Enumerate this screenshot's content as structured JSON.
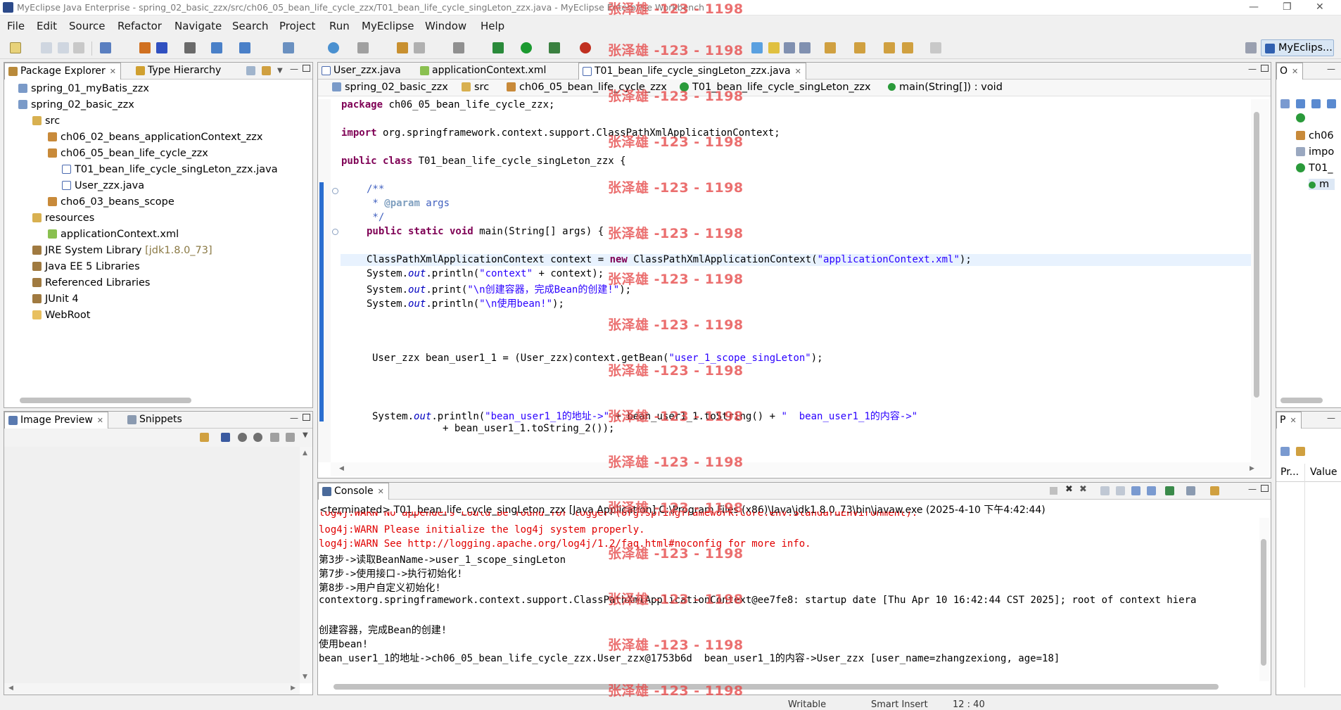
{
  "window": {
    "title": "MyEclipse Java Enterprise - spring_02_basic_zzx/src/ch06_05_bean_life_cycle_zzx/T01_bean_life_cycle_singLeton_zzx.java - MyEclipse Enterprise Workbench"
  },
  "menu": [
    "File",
    "Edit",
    "Source",
    "Refactor",
    "Navigate",
    "Search",
    "Project",
    "Run",
    "MyEclipse",
    "Window",
    "Help"
  ],
  "perspective": {
    "label": "MyEclips..."
  },
  "package_explorer": {
    "tabs": [
      {
        "label": "Package Explorer"
      },
      {
        "label": "Type Hierarchy"
      }
    ],
    "tree": [
      {
        "label": "spring_01_myBatis_zzx",
        "icon": "project-icon"
      },
      {
        "label": "spring_02_basic_zzx",
        "icon": "project-icon"
      },
      {
        "label": "src",
        "icon": "source-folder-icon"
      },
      {
        "label": "ch06_02_beans_applicationContext_zzx",
        "icon": "package-icon"
      },
      {
        "label": "ch06_05_bean_life_cycle_zzx",
        "icon": "package-icon"
      },
      {
        "label": "T01_bean_life_cycle_singLeton_zzx.java",
        "icon": "java-file-icon"
      },
      {
        "label": "User_zzx.java",
        "icon": "java-file-icon"
      },
      {
        "label": "cho6_03_beans_scope",
        "icon": "package-icon"
      },
      {
        "label": "resources",
        "icon": "source-folder-icon"
      },
      {
        "label": "applicationContext.xml",
        "icon": "xml-file-icon"
      },
      {
        "label": "JRE System Library",
        "suffix": "[jdk1.8.0_73]",
        "icon": "library-icon"
      },
      {
        "label": "Java EE 5 Libraries",
        "icon": "library-icon"
      },
      {
        "label": "Referenced Libraries",
        "icon": "library-icon"
      },
      {
        "label": "JUnit 4",
        "icon": "library-icon"
      },
      {
        "label": "WebRoot",
        "icon": "folder-icon"
      }
    ]
  },
  "image_preview": {
    "tabs": [
      {
        "label": "Image Preview"
      },
      {
        "label": "Snippets"
      }
    ]
  },
  "editor": {
    "tabs": [
      {
        "label": "User_zzx.java"
      },
      {
        "label": "applicationContext.xml"
      },
      {
        "label": "T01_bean_life_cycle_singLeton_zzx.java"
      }
    ],
    "breadcrumb": [
      "spring_02_basic_zzx",
      "src",
      "ch06_05_bean_life_cycle_zzx",
      "T01_bean_life_cycle_singLeton_zzx",
      "main(String[]) : void"
    ],
    "code": {
      "l1_kw": "package",
      "l1_rest": " ch06_05_bean_life_cycle_zzx;",
      "l2_kw": "import",
      "l2_rest": " org.springframework.context.support.ClassPathXmlApplicationContext;",
      "l3_kw": "public class",
      "l3_rest": " T01_bean_life_cycle_singLeton_zzx {",
      "l4": "/**",
      "l5_a": " * ",
      "l5_tag": "@param",
      "l5_b": " args",
      "l6": " */",
      "l7_kw": "public static void",
      "l7_rest": " main(String[] args) {",
      "l8_a": "ClassPathXmlApplicationContext context = ",
      "l8_kw": "new",
      "l8_b": " ClassPathXmlApplicationContext(",
      "l8_str": "\"applicationContext.xml\"",
      "l8_c": ");",
      "l9_a": "System.",
      "l9_fld": "out",
      "l9_b": ".println(",
      "l9_str": "\"context\"",
      "l9_c": " + context);",
      "l10_a": "System.",
      "l10_fld": "out",
      "l10_b": ".print(",
      "l10_str": "\"\\n创建容器，完成Bean的创建!\"",
      "l10_c": ");",
      "l11_a": "System.",
      "l11_fld": "out",
      "l11_b": ".println(",
      "l11_str": "\"\\n使用bean!\"",
      "l11_c": ");",
      "l12_a": "User_zzx bean_user1_1 = (User_zzx)context.getBean(",
      "l12_str": "\"user_1_scope_singLeton\"",
      "l12_c": ");",
      "l13_a": "System.",
      "l13_fld": "out",
      "l13_b": ".println(",
      "l13_str": "\"bean_user1_1的地址->\"",
      "l13_c": " + bean_user1_1.toString() + ",
      "l13_str2": "\"  bean_user1_1的内容->\"",
      "l14": "+ bean_user1_1.toString_2());"
    }
  },
  "console": {
    "tab": {
      "label": "Console"
    },
    "header": "<terminated> T01_bean_life_cycle_singLeton_zzx [Java Application] C:\\Program Files (x86)\\Java\\jdk1.8.0_73\\bin\\javaw.exe (2025-4-10 下午4:42:44)",
    "lines": [
      {
        "text": "log4j:WARN No appenders could be found for logger (org.springframework.core.env.StandardEnvironment).",
        "err": true
      },
      {
        "text": "log4j:WARN Please initialize the log4j system properly.",
        "err": true
      },
      {
        "text": "log4j:WARN See http://logging.apache.org/log4j/1.2/faq.html#noconfig for more info.",
        "err": true
      },
      {
        "text": "第3步->读取BeanName->user_1_scope_singLeton",
        "err": false
      },
      {
        "text": "第7步->使用接口->执行初始化!",
        "err": false
      },
      {
        "text": "第8步->用户自定义初始化!",
        "err": false
      },
      {
        "text": "contextorg.springframework.context.support.ClassPathXmlApplicationContext@ee7fe8: startup date [Thu Apr 10 16:42:44 CST 2025]; root of context hiera",
        "err": false
      },
      {
        "text": "",
        "err": false
      },
      {
        "text": "创建容器，完成Bean的创建!",
        "err": false
      },
      {
        "text": "使用bean!",
        "err": false
      },
      {
        "text": "bean_user1_1的地址->ch06_05_bean_life_cycle_zzx.User_zzx@1753b6d  bean_user1_1的内容->User_zzx [user_name=zhangzexiong, age=18]",
        "err": false
      }
    ]
  },
  "outline": {
    "tab": {
      "label": "O"
    },
    "items": [
      "ch06",
      "impo",
      "T01_",
      "m"
    ]
  },
  "properties": {
    "tab": {
      "label": "P"
    },
    "columns": [
      "Pr...",
      "Value"
    ]
  },
  "status_bar": {
    "writable": "Writable",
    "insert_mode": "Smart Insert",
    "position": "12 : 40"
  },
  "watermark": "张泽雄 -123 - 1198",
  "colors": {
    "keyword": "#7f0055",
    "string": "#2a00ff",
    "comment": "#3f5fbf",
    "error": "#e00000",
    "watermark": "#e64646"
  }
}
